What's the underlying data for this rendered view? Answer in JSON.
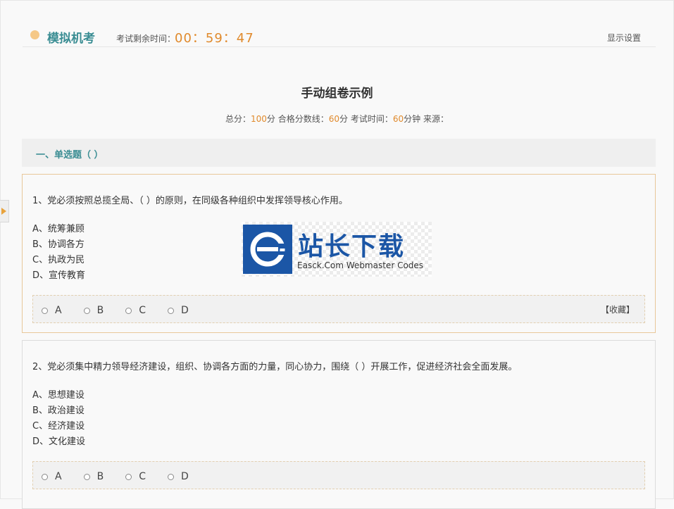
{
  "header": {
    "app_title": "模拟机考",
    "timer_label": "考试剩余时间：",
    "timer_value": "00：59：47",
    "display_settings": "显示设置"
  },
  "exam": {
    "title": "手动组卷示例",
    "info": {
      "total_label": "总分：",
      "total_value": "100",
      "unit": "分",
      "pass_label": " 合格分数线：",
      "pass_value": "60",
      "time_label": " 考试时间：",
      "time_value": "60",
      "time_unit": "分钟",
      "source_label": " 来源："
    }
  },
  "section": {
    "title": "一、单选题（ ）"
  },
  "questions": [
    {
      "text": "1、党必须按照总揽全局、（ ）的原则，在同级各种组织中发挥领导核心作用。",
      "options": [
        "A、统筹兼顾",
        "B、协调各方",
        "C、执政为民",
        "D、宣传教育"
      ],
      "answers": [
        "A",
        "B",
        "C",
        "D"
      ],
      "favorite": "【收藏】"
    },
    {
      "text": "2、党必须集中精力领导经济建设，组织、协调各方面的力量，同心协力，围绕（ ）开展工作，促进经济社会全面发展。",
      "options": [
        "A、思想建设",
        "B、政治建设",
        "C、经济建设",
        "D、文化建设"
      ],
      "answers": [
        "A",
        "B",
        "C",
        "D"
      ]
    }
  ],
  "watermark": {
    "cn": "站长下载",
    "en": "Easck.Com Webmaster Codes"
  },
  "colors": {
    "accent_teal": "#3a8d93",
    "accent_orange": "#e08a2c",
    "watermark_blue": "#1b56a6"
  }
}
